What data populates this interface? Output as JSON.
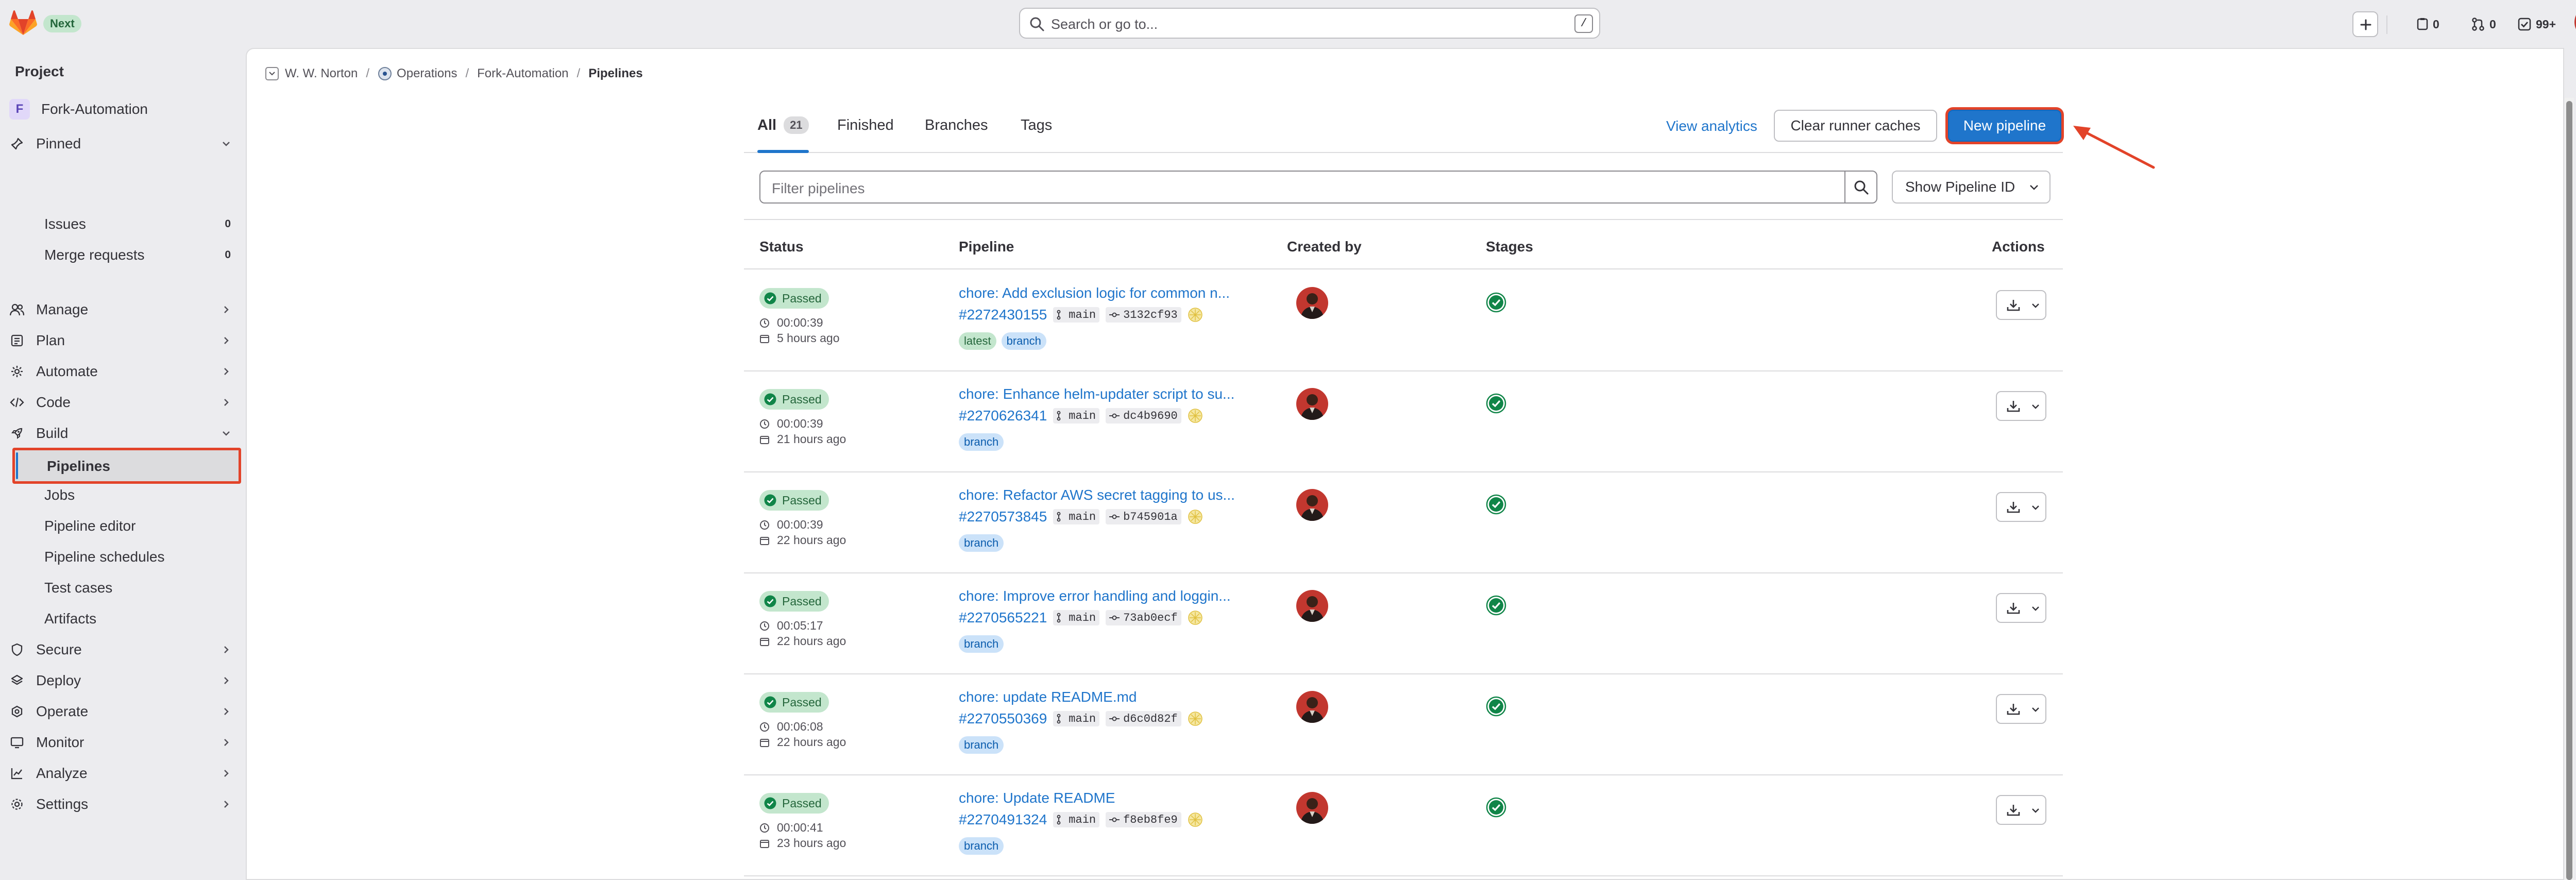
{
  "topbar": {
    "next_label": "Next",
    "search_placeholder": "Search or go to...",
    "search_shortcut": "/",
    "issues_count": "0",
    "merge_requests_count": "0",
    "todos_count": "99+"
  },
  "sidebar": {
    "heading": "Project",
    "project_initial": "F",
    "project_name": "Fork-Automation",
    "pinned_label": "Pinned",
    "pinned_items": [
      {
        "label": "Issues",
        "count": "0"
      },
      {
        "label": "Merge requests",
        "count": "0"
      }
    ],
    "groups": [
      {
        "label": "Manage",
        "icon": "users-icon"
      },
      {
        "label": "Plan",
        "icon": "planning-icon"
      },
      {
        "label": "Automate",
        "icon": "rocket-icon"
      },
      {
        "label": "Code",
        "icon": "code-icon"
      },
      {
        "label": "Build",
        "icon": "rocket-icon"
      }
    ],
    "build_items": [
      "Pipelines",
      "Jobs",
      "Pipeline editor",
      "Pipeline schedules",
      "Test cases",
      "Artifacts"
    ],
    "bottom_groups": [
      {
        "label": "Secure",
        "icon": "shield-icon"
      },
      {
        "label": "Deploy",
        "icon": "deploy-icon"
      },
      {
        "label": "Operate",
        "icon": "operate-icon"
      },
      {
        "label": "Monitor",
        "icon": "monitor-icon"
      },
      {
        "label": "Analyze",
        "icon": "chart-icon"
      },
      {
        "label": "Settings",
        "icon": "gear-icon"
      }
    ]
  },
  "breadcrumb": [
    "W. W. Norton",
    "Operations",
    "Fork-Automation",
    "Pipelines"
  ],
  "tabs": [
    {
      "label": "All",
      "count": "21"
    },
    {
      "label": "Finished"
    },
    {
      "label": "Branches"
    },
    {
      "label": "Tags"
    }
  ],
  "actions": {
    "view_analytics": "View analytics",
    "clear_caches": "Clear runner caches",
    "new_pipeline": "New pipeline"
  },
  "filter": {
    "placeholder": "Filter pipelines",
    "id_toggle": "Show Pipeline ID"
  },
  "table": {
    "headers": [
      "Status",
      "Pipeline",
      "Created by",
      "Stages",
      "Actions"
    ],
    "rows": [
      {
        "status": "Passed",
        "duration": "00:00:39",
        "finished": "5 hours ago",
        "title": "chore: Add exclusion logic for common n...",
        "id": "#2272430155",
        "ref": "main",
        "sha": "3132cf93",
        "tags": [
          "latest",
          "branch"
        ]
      },
      {
        "status": "Passed",
        "duration": "00:00:39",
        "finished": "21 hours ago",
        "title": "chore: Enhance helm-updater script to su...",
        "id": "#2270626341",
        "ref": "main",
        "sha": "dc4b9690",
        "tags": [
          "branch"
        ]
      },
      {
        "status": "Passed",
        "duration": "00:00:39",
        "finished": "22 hours ago",
        "title": "chore: Refactor AWS secret tagging to us...",
        "id": "#2270573845",
        "ref": "main",
        "sha": "b745901a",
        "tags": [
          "branch"
        ]
      },
      {
        "status": "Passed",
        "duration": "00:05:17",
        "finished": "22 hours ago",
        "title": "chore: Improve error handling and loggin...",
        "id": "#2270565221",
        "ref": "main",
        "sha": "73ab0ecf",
        "tags": [
          "branch"
        ]
      },
      {
        "status": "Passed",
        "duration": "00:06:08",
        "finished": "22 hours ago",
        "title": "chore: update README.md",
        "id": "#2270550369",
        "ref": "main",
        "sha": "d6c0d82f",
        "tags": [
          "branch"
        ]
      },
      {
        "status": "Passed",
        "duration": "00:00:41",
        "finished": "23 hours ago",
        "title": "chore: Update README",
        "id": "#2270491324",
        "ref": "main",
        "sha": "f8eb8fe9",
        "tags": [
          "branch"
        ]
      }
    ]
  },
  "colors": {
    "accent": "#1f75cb",
    "success": "#108548",
    "highlight": "#e24329"
  }
}
